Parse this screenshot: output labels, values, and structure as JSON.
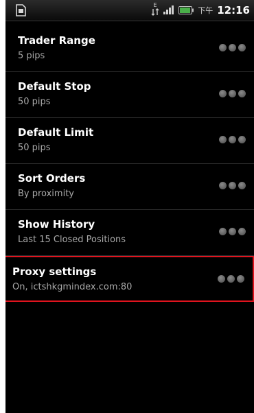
{
  "status_bar": {
    "ampm": "下午",
    "time": "12:16",
    "left_icon": "sd-card-icon",
    "right_icons": [
      "data-transfer-icon",
      "signal-icon",
      "battery-icon"
    ]
  },
  "settings": [
    {
      "title": "Trader Range",
      "summary": "5 pips"
    },
    {
      "title": "Default Stop",
      "summary": "50 pips"
    },
    {
      "title": "Default Limit",
      "summary": "50 pips"
    },
    {
      "title": "Sort Orders",
      "summary": "By proximity"
    },
    {
      "title": "Show History",
      "summary": "Last 15 Closed Positions"
    },
    {
      "title": "Proxy settings",
      "summary": "On, ictshkgmindex.com:80"
    }
  ],
  "colors": {
    "background": "#000000",
    "highlight": "#e0141e",
    "summary_text": "#a8a8a8",
    "battery": "#4ab04a"
  }
}
